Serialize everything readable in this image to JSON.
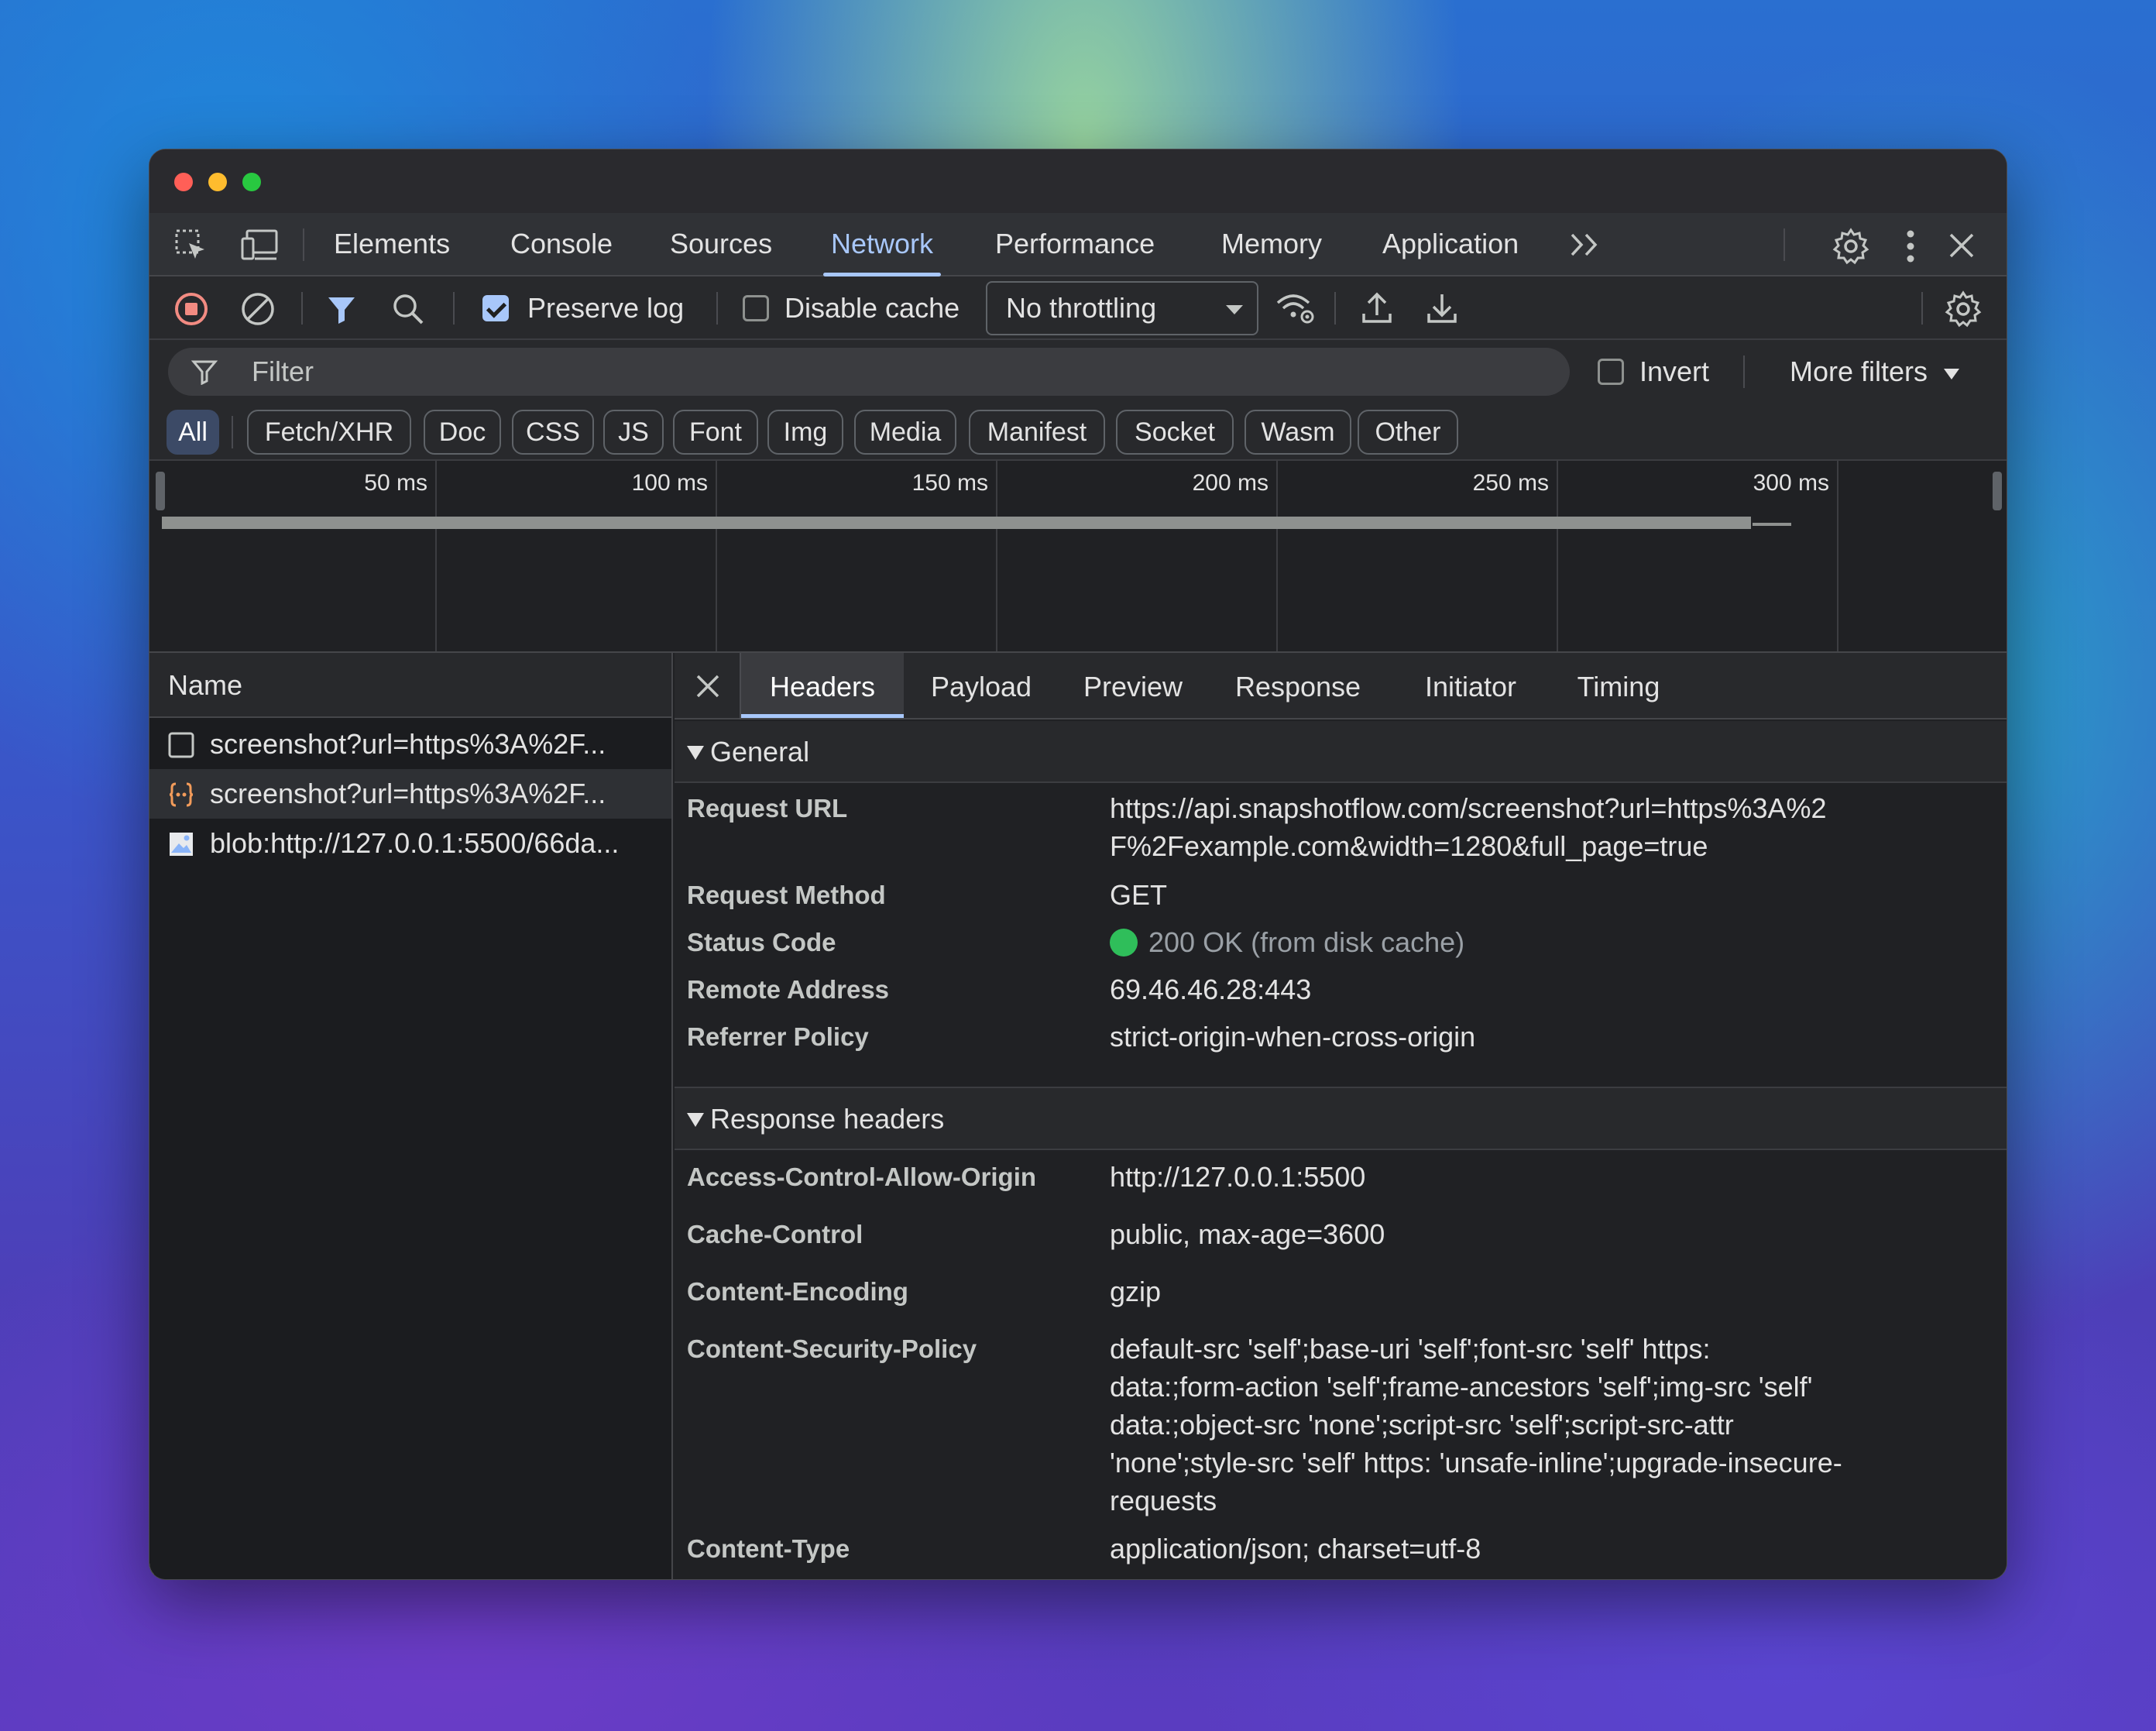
{
  "main_tabs": [
    "Elements",
    "Console",
    "Sources",
    "Network",
    "Performance",
    "Memory",
    "Application"
  ],
  "active_main_tab": "Network",
  "toolbar": {
    "preserve_log_label": "Preserve log",
    "preserve_log_checked": true,
    "disable_cache_label": "Disable cache",
    "disable_cache_checked": false,
    "throttling_value": "No throttling"
  },
  "filter": {
    "placeholder": "Filter",
    "invert_label": "Invert",
    "more_filters_label": "More filters"
  },
  "type_filters": [
    "All",
    "Fetch/XHR",
    "Doc",
    "CSS",
    "JS",
    "Font",
    "Img",
    "Media",
    "Manifest",
    "Socket",
    "Wasm",
    "Other"
  ],
  "active_type_filter": "All",
  "timeline": {
    "ticks": [
      "50 ms",
      "100 ms",
      "150 ms",
      "200 ms",
      "250 ms",
      "300 ms"
    ]
  },
  "requests": {
    "header": "Name",
    "items": [
      {
        "name": "screenshot?url=https%3A%2F...",
        "icon": "checkbox-icon"
      },
      {
        "name": "screenshot?url=https%3A%2F...",
        "icon": "json-icon"
      },
      {
        "name": "blob:http://127.0.0.1:5500/66da...",
        "icon": "image-icon"
      }
    ]
  },
  "details": {
    "tabs": [
      "Headers",
      "Payload",
      "Preview",
      "Response",
      "Initiator",
      "Timing"
    ],
    "active_tab": "Headers",
    "general": {
      "title": "General",
      "rows": [
        {
          "key": "Request URL",
          "value": "https://api.snapshotflow.com/screenshot?url=https%3A%2F%2Fexample.com&width=1280&full_page=true"
        },
        {
          "key": "Request Method",
          "value": "GET"
        },
        {
          "key": "Status Code",
          "value": "200 OK (from disk cache)"
        },
        {
          "key": "Remote Address",
          "value": "69.46.46.28:443"
        },
        {
          "key": "Referrer Policy",
          "value": "strict-origin-when-cross-origin"
        }
      ]
    },
    "response_headers": {
      "title": "Response headers",
      "rows": [
        {
          "key": "Access-Control-Allow-Origin",
          "value": "http://127.0.0.1:5500"
        },
        {
          "key": "Cache-Control",
          "value": "public, max-age=3600"
        },
        {
          "key": "Content-Encoding",
          "value": "gzip"
        },
        {
          "key": "Content-Security-Policy",
          "value": "default-src 'self';base-uri 'self';font-src 'self' https: data:;form-action 'self';frame-ancestors 'self';img-src 'self' data:;object-src 'none';script-src 'self';script-src-attr 'none';style-src 'self' https: 'unsafe-inline';upgrade-insecure-requests"
        },
        {
          "key": "Content-Type",
          "value": "application/json; charset=utf-8"
        }
      ]
    }
  },
  "colors": {
    "accent": "#a8c7fa",
    "record": "#f28b82",
    "status_ok": "#2fbe5a"
  }
}
